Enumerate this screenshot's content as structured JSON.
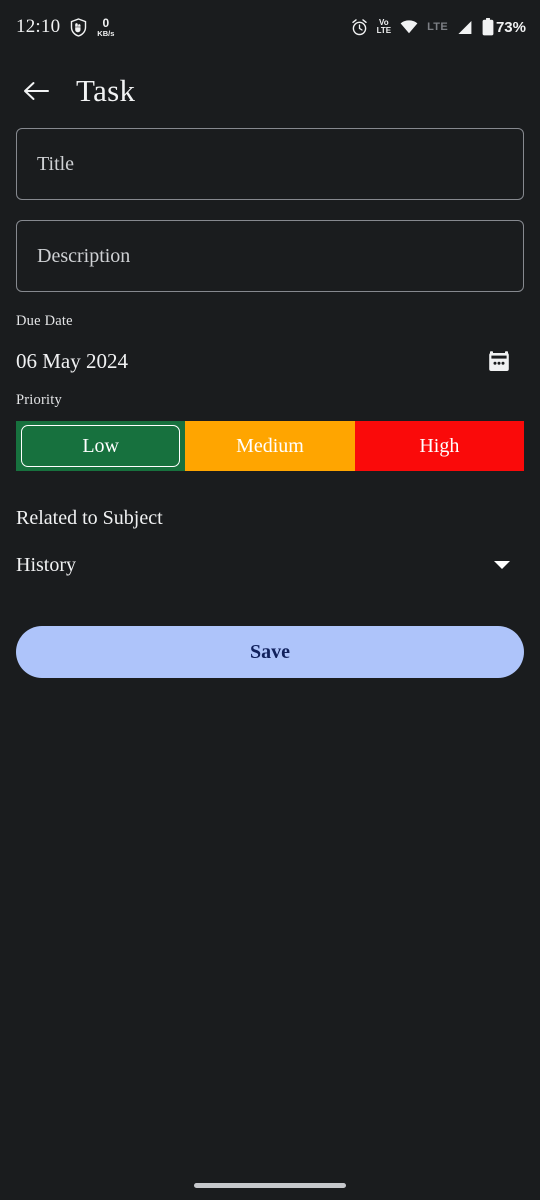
{
  "theme": {
    "background": "#1a1c1e",
    "text": "#f0f1f2",
    "field_border": "#86898f",
    "priority_low_color": "#17713E",
    "priority_medium_color": "#FFA500",
    "priority_high_color": "#FA0A0A",
    "save_bg": "#aec4fa",
    "save_text": "#11215c"
  },
  "status_bar": {
    "time": "12:10",
    "shield_icon": "shield-icon",
    "net_speed_value": "0",
    "net_speed_unit": "KB/s",
    "alarm_icon": "alarm-icon",
    "volte_top": "Vo",
    "volte_bottom": "LTE",
    "wifi_icon": "wifi-icon",
    "network_type": "LTE",
    "signal_icon": "signal-icon",
    "battery_icon": "battery-icon",
    "battery_percent": "73%"
  },
  "appbar": {
    "back_icon": "arrow-left-icon",
    "title": "Task"
  },
  "form": {
    "title_placeholder": "Title",
    "title_value": "",
    "description_placeholder": "Description",
    "description_value": "",
    "due_date_label": "Due Date",
    "due_date_value": "06 May 2024",
    "calendar_icon": "calendar-icon",
    "priority_label": "Priority",
    "priority_options": [
      {
        "label": "Low",
        "color": "#17713E",
        "selected": true
      },
      {
        "label": "Medium",
        "color": "#FFA500",
        "selected": false
      },
      {
        "label": "High",
        "color": "#FA0A0A",
        "selected": false
      }
    ],
    "subject_label": "Related to Subject",
    "subject_value": "History",
    "dropdown_icon": "chevron-down-icon",
    "save_label": "Save"
  },
  "nav": {
    "home_indicator": "home-indicator"
  }
}
